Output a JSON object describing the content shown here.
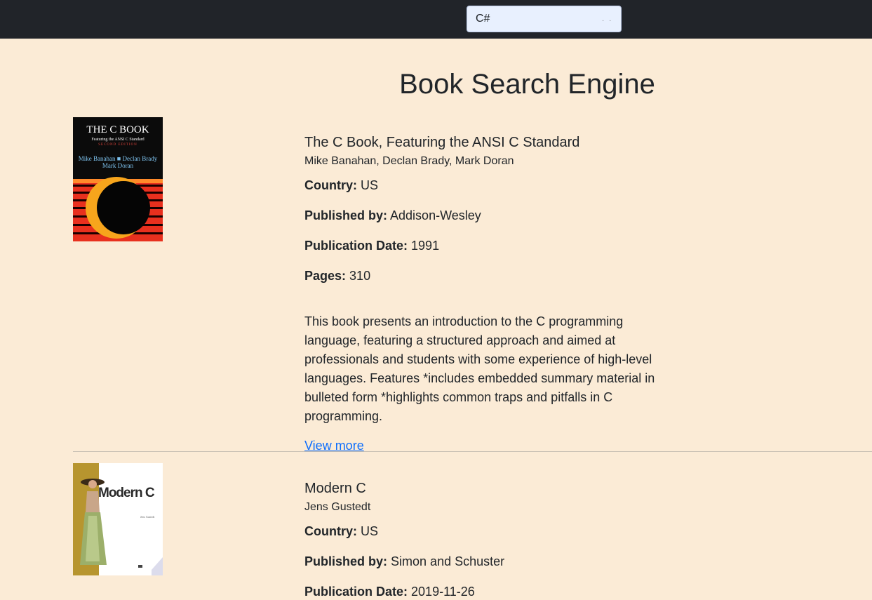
{
  "search": {
    "value": "C#",
    "placeholder": ""
  },
  "page_title": "Book Search Engine",
  "labels": {
    "country": "Country:",
    "published_by": "Published by:",
    "publication_date": "Publication Date:",
    "pages": "Pages:",
    "view_more": "View more"
  },
  "books": [
    {
      "title": "The C Book, Featuring the ANSI C Standard",
      "authors": "Mike Banahan, Declan Brady, Mark Doran",
      "country": "US",
      "publisher": "Addison-Wesley",
      "publication_date": "1991",
      "pages": "310",
      "description": "This book presents an introduction to the C programming language, featuring a structured approach and aimed at professionals and students with some experience of high-level languages. Features *includes embedded summary material in bulleted form *highlights common traps and pitfalls in C programming.",
      "cover": {
        "title": "THE C BOOK",
        "subtitle": "Featuring the ANSI C Standard",
        "edition": "SECOND EDITION",
        "authors_line1": "Mike Banahan ■ Declan Brady",
        "authors_line2": "Mark Doran"
      }
    },
    {
      "title": "Modern C",
      "authors": "Jens Gustedt",
      "country": "US",
      "publisher": "Simon and Schuster",
      "publication_date": "2019-11-26",
      "cover": {
        "title": "Modern C",
        "author": "Jens Gustedt"
      }
    }
  ]
}
